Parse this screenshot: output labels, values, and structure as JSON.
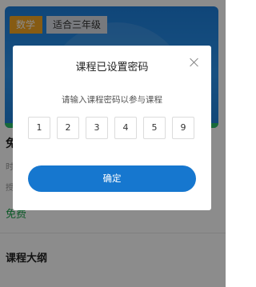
{
  "course": {
    "subject_tag": "数学",
    "grade_tag": "适合三年级",
    "title_partial": "免",
    "meta_line1_partial": "时",
    "meta_line2_partial": "授",
    "price": "免费"
  },
  "outline": {
    "title": "课程大纲"
  },
  "dialog": {
    "title": "课程已设置密码",
    "hint": "请输入课程密码以参与课程",
    "digits": [
      "1",
      "2",
      "3",
      "4",
      "5",
      "9"
    ],
    "confirm_label": "确定"
  },
  "colors": {
    "accent_blue": "#1677cf",
    "tag_orange": "#f5a623",
    "price_green": "#19a34a"
  },
  "icons": {
    "close": "close-icon"
  }
}
